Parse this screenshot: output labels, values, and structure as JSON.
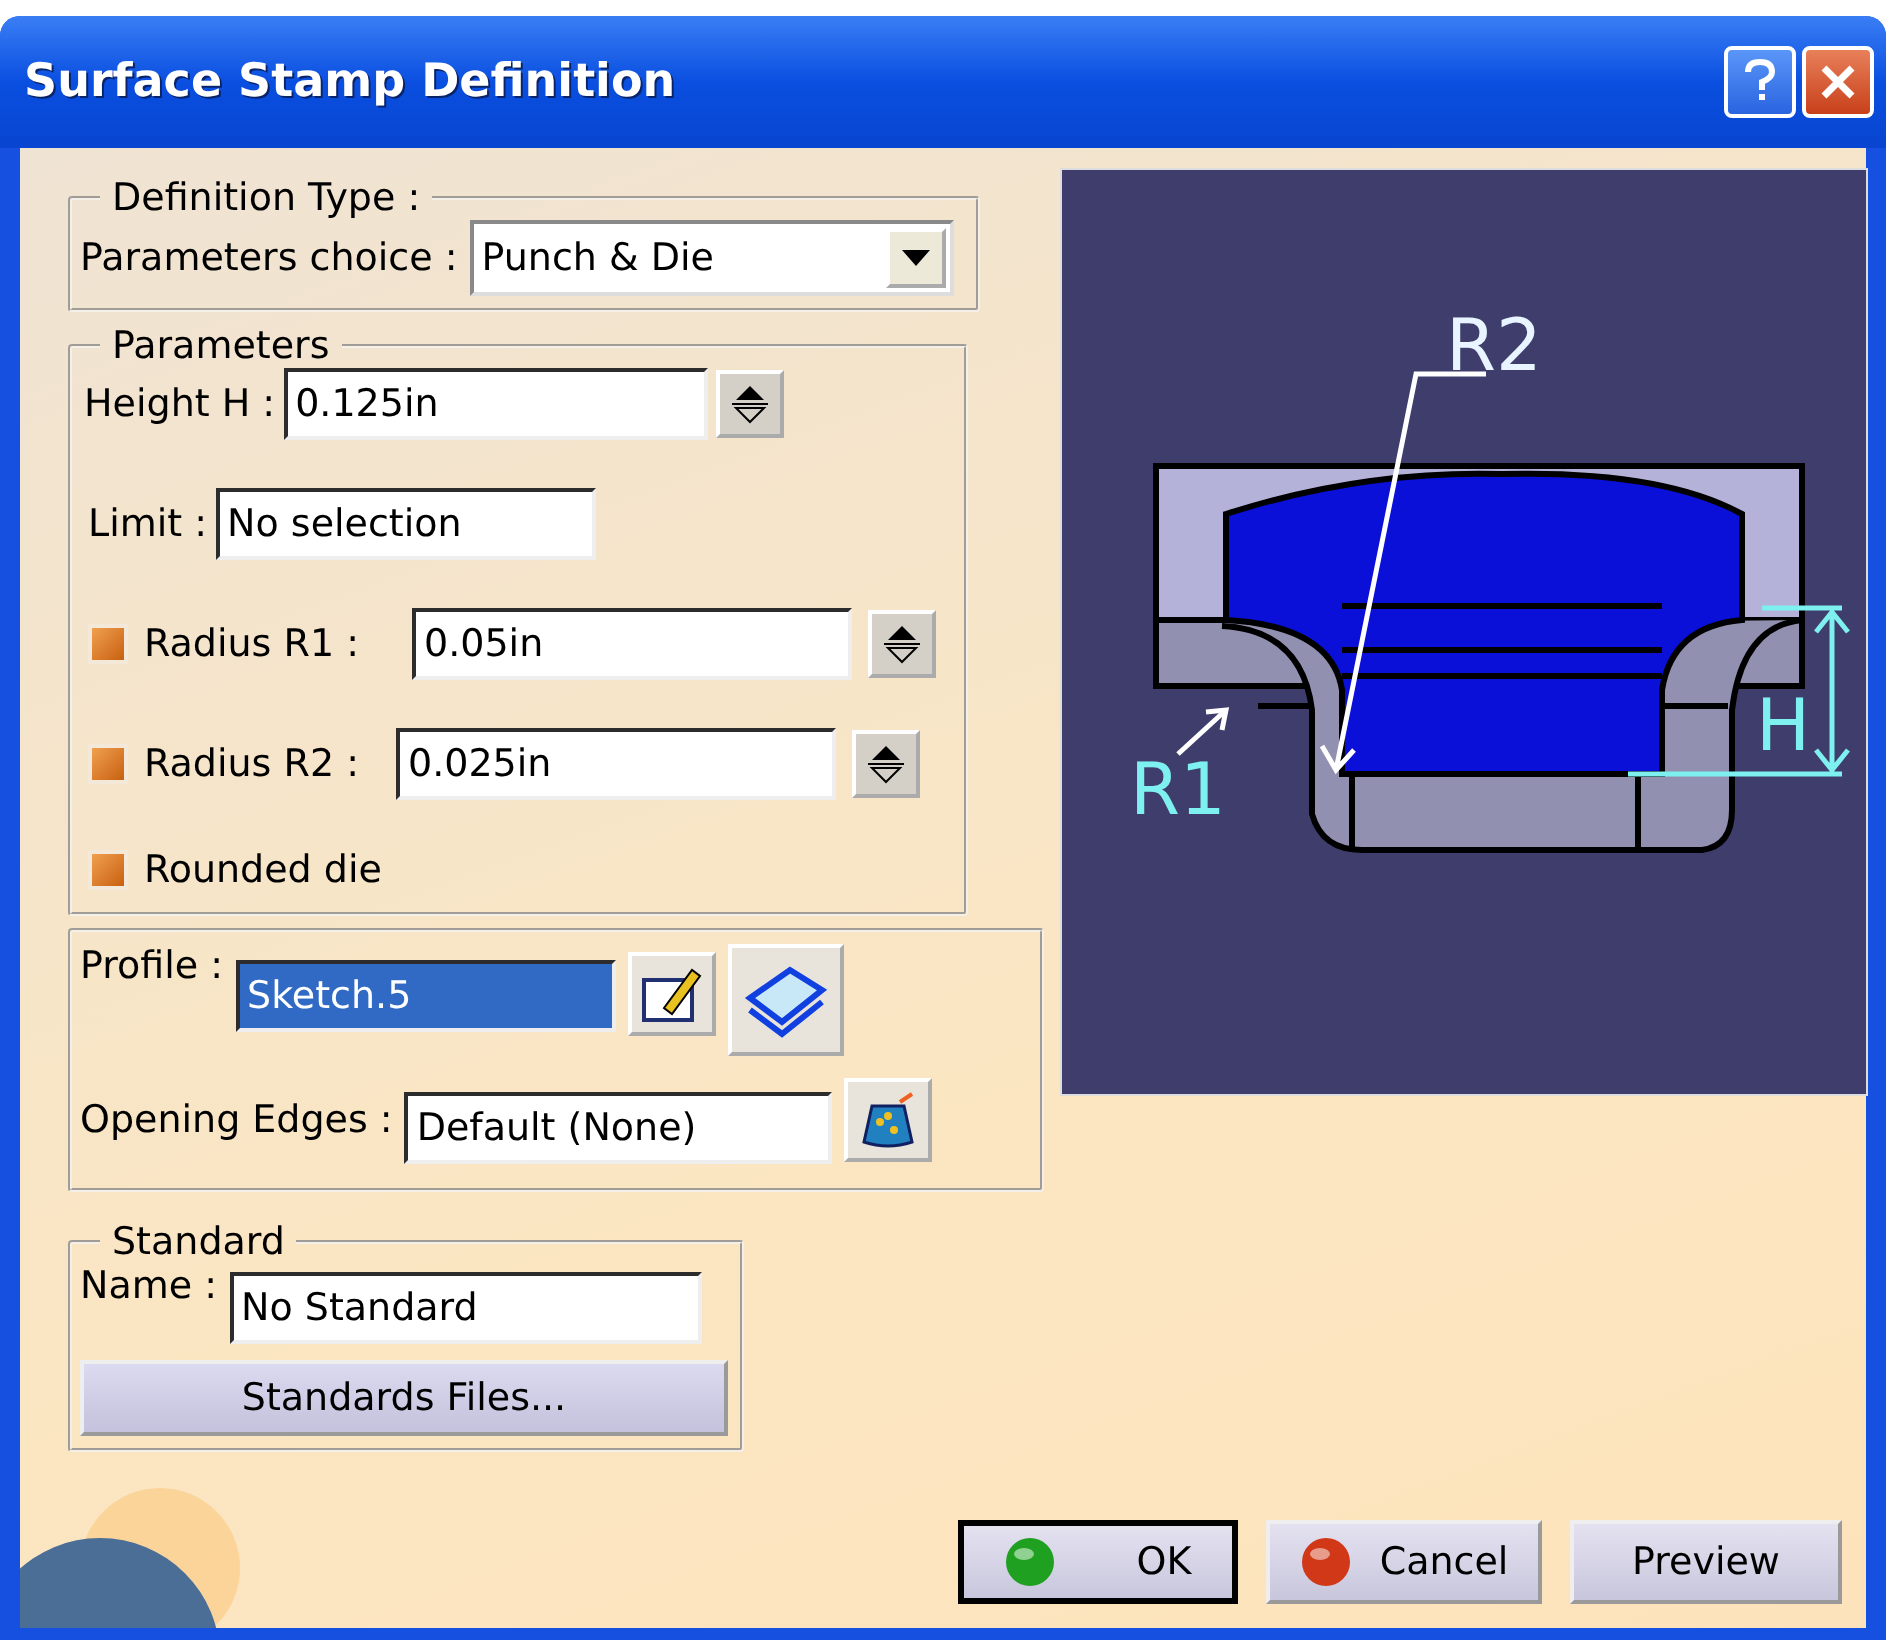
{
  "window": {
    "title": "Surface Stamp Definition"
  },
  "definition_type": {
    "legend": "Definition Type :",
    "label": "Parameters choice :",
    "value": "Punch & Die"
  },
  "parameters": {
    "legend": "Parameters",
    "rows": [
      {
        "kind": "spin",
        "label": "Height H :",
        "value": "0.125in"
      },
      {
        "kind": "text",
        "label": "Limit :",
        "value": "No selection"
      },
      {
        "kind": "check_spin",
        "label": "Radius R1 :",
        "value": "0.05in",
        "checked": true
      },
      {
        "kind": "check_spin",
        "label": "Radius R2 :",
        "value": "0.025in",
        "checked": true
      },
      {
        "kind": "check",
        "label": "Rounded die",
        "checked": true
      }
    ]
  },
  "profile": {
    "label": "Profile :",
    "value": "Sketch.5",
    "selected": true
  },
  "opening_edges": {
    "label": "Opening Edges :",
    "value": "Default (None)"
  },
  "standard": {
    "legend": "Standard",
    "label": "Name :",
    "value": "No Standard",
    "button": "Standards Files..."
  },
  "diagram": {
    "labels": [
      "R2",
      "R1",
      "H"
    ]
  },
  "buttons": [
    {
      "kind": "ok",
      "label": "OK",
      "default": true
    },
    {
      "kind": "cancel",
      "label": "Cancel",
      "default": false
    },
    {
      "kind": "plain",
      "label": "Preview",
      "default": false
    }
  ]
}
